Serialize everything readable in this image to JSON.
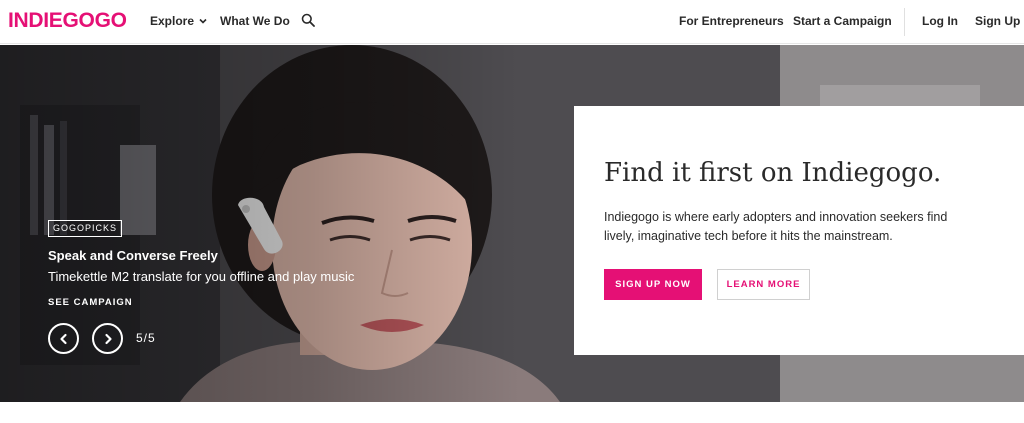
{
  "brand": {
    "logo_text": "INDIEGOGO",
    "accent_color": "#e51075"
  },
  "nav": {
    "explore_label": "Explore",
    "what_we_do_label": "What We Do",
    "search_icon": "search-icon",
    "for_entrepreneurs_label": "For Entrepreneurs",
    "start_campaign_label": "Start a Campaign",
    "login_label": "Log In",
    "signup_label": "Sign Up"
  },
  "hero": {
    "tag": "GOGOPICKS",
    "title": "Speak and Converse Freely",
    "subtitle": "Timekettle M2 translate for you offline and play music",
    "cta": "SEE CAMPAIGN",
    "prev_icon": "chevron-left-icon",
    "next_icon": "chevron-right-icon",
    "slide_counter": "5/5"
  },
  "promo": {
    "title": "Find it first on Indiegogo.",
    "body": "Indiegogo is where early adopters and innovation seekers find lively, imaginative tech before it hits the mainstream.",
    "primary_button": "SIGN UP NOW",
    "secondary_button": "LEARN MORE"
  }
}
